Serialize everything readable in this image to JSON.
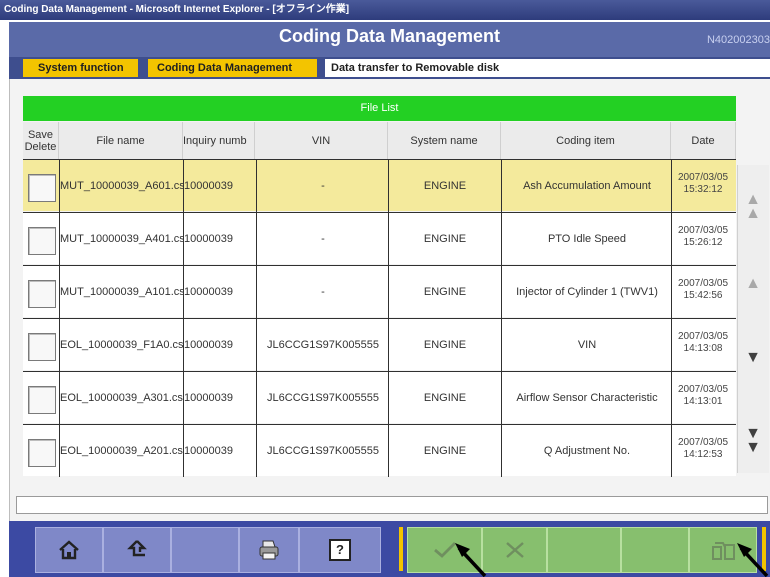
{
  "window": {
    "title": "Coding Data Management - Microsoft Internet Explorer - [オフライン作業]"
  },
  "header": {
    "title": "Coding Data Management",
    "code": "N402002303"
  },
  "breadcrumb": {
    "items": [
      "System function",
      "Coding Data Management",
      "Data transfer to Removable disk"
    ]
  },
  "table": {
    "title": "File List",
    "columns": [
      "Save\nDelete",
      "File name",
      "Inquiry numb",
      "VIN",
      "System name",
      "Coding item",
      "Date"
    ],
    "rows": [
      {
        "file": "MUT_10000039_A601.cs",
        "inquiry": "10000039",
        "vin": "-",
        "system": "ENGINE",
        "item": "Ash Accumulation Amount",
        "date": "2007/03/05",
        "time": "15:32:12",
        "selected": true
      },
      {
        "file": "MUT_10000039_A401.cs",
        "inquiry": "10000039",
        "vin": "-",
        "system": "ENGINE",
        "item": "PTO Idle Speed",
        "date": "2007/03/05",
        "time": "15:26:12",
        "selected": false
      },
      {
        "file": "MUT_10000039_A101.cs",
        "inquiry": "10000039",
        "vin": "-",
        "system": "ENGINE",
        "item": "Injector of Cylinder 1 (TWV1)",
        "date": "2007/03/05",
        "time": "15:42:56",
        "selected": false
      },
      {
        "file": "EOL_10000039_F1A0.cs",
        "inquiry": "10000039",
        "vin": "JL6CCG1S97K005555",
        "system": "ENGINE",
        "item": "VIN",
        "date": "2007/03/05",
        "time": "14:13:08",
        "selected": false
      },
      {
        "file": "EOL_10000039_A301.cs",
        "inquiry": "10000039",
        "vin": "JL6CCG1S97K005555",
        "system": "ENGINE",
        "item": "Airflow Sensor Characteristic",
        "date": "2007/03/05",
        "time": "14:13:01",
        "selected": false
      },
      {
        "file": "EOL_10000039_A201.cs",
        "inquiry": "10000039",
        "vin": "JL6CCG1S97K005555",
        "system": "ENGINE",
        "item": "Q Adjustment No.",
        "date": "2007/03/05",
        "time": "14:12:53",
        "selected": false
      }
    ]
  },
  "toolbar": {
    "left": [
      "home-icon",
      "back-icon",
      "blank",
      "print-icon",
      "help-icon"
    ],
    "help_label": "?",
    "right": [
      "confirm-icon",
      "cancel-icon",
      "blank",
      "blank",
      "save-to-disk-icon"
    ]
  },
  "colors": {
    "header": "#5a6aa8",
    "crumb": "#f3c400",
    "list_header": "#23d023",
    "selected_row": "#f4ea9c",
    "toolbar": "#3c4aa3",
    "green_button": "#87bf6e"
  }
}
